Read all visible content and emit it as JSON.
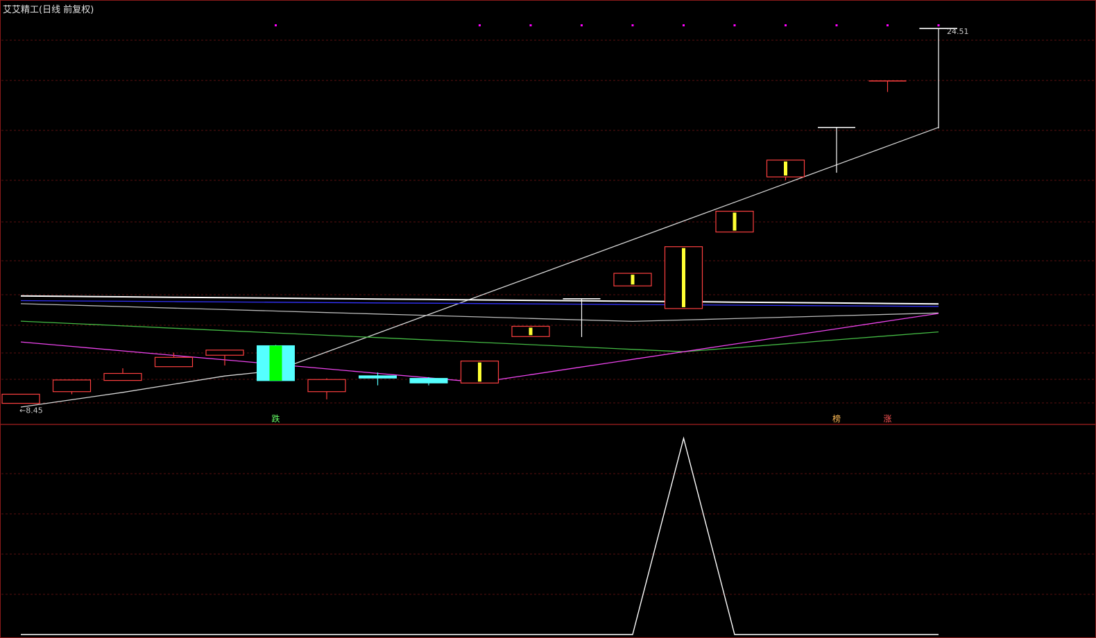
{
  "window": {
    "title": "艾艾精工(日线 前复权)"
  },
  "colors": {
    "background": "#000000",
    "border": "#8b1a1a",
    "grid": "#5a1010",
    "up": "#ff4040",
    "down": "#55ffff",
    "signal_bar": "#ffff33",
    "signal_bar_down": "#00ff00",
    "top_dot": "#ff00ff"
  },
  "chart_data": [
    {
      "type": "candlestick",
      "title": "艾艾精工(日线 前复权)",
      "grid": true,
      "candles": [
        {
          "open": 8.45,
          "close": 8.84,
          "high": 8.84,
          "low": 8.45,
          "dir": "up"
        },
        {
          "open": 8.95,
          "close": 9.45,
          "high": 9.45,
          "low": 8.84,
          "dir": "up"
        },
        {
          "open": 9.43,
          "close": 9.73,
          "high": 9.95,
          "low": 9.43,
          "dir": "up"
        },
        {
          "open": 10.02,
          "close": 10.42,
          "high": 10.62,
          "low": 10.02,
          "dir": "up"
        },
        {
          "open": 10.51,
          "close": 10.73,
          "high": 10.73,
          "low": 10.07,
          "dir": "up"
        },
        {
          "open": 10.92,
          "close": 9.42,
          "high": 10.95,
          "low": 9.42,
          "dir": "down",
          "signal": "down"
        },
        {
          "open": 8.95,
          "close": 9.47,
          "high": 9.52,
          "low": 8.62,
          "dir": "up"
        },
        {
          "open": 9.63,
          "close": 9.53,
          "high": 9.77,
          "low": 9.22,
          "dir": "down"
        },
        {
          "open": 9.52,
          "close": 9.32,
          "high": 9.57,
          "low": 9.22,
          "dir": "down"
        },
        {
          "open": 9.32,
          "close": 10.26,
          "high": 10.26,
          "low": 9.32,
          "dir": "up",
          "signal": "up"
        },
        {
          "open": 11.31,
          "close": 11.75,
          "high": 11.75,
          "low": 11.31,
          "dir": "up",
          "signal": "up"
        },
        {
          "open": 12.93,
          "close": 12.93,
          "high": 12.93,
          "low": 11.29,
          "dir": "flat"
        },
        {
          "open": 13.48,
          "close": 14.02,
          "high": 14.02,
          "low": 13.48,
          "dir": "up",
          "signal": "up"
        },
        {
          "open": 12.51,
          "close": 15.16,
          "high": 15.16,
          "low": 12.51,
          "dir": "up",
          "signal": "up"
        },
        {
          "open": 15.79,
          "close": 16.68,
          "high": 16.68,
          "low": 15.79,
          "dir": "up",
          "signal": "up"
        },
        {
          "open": 18.15,
          "close": 18.87,
          "high": 18.87,
          "low": 18.0,
          "dir": "up",
          "signal": "up"
        },
        {
          "open": 20.27,
          "close": 20.27,
          "high": 20.27,
          "low": 18.33,
          "dir": "flat"
        },
        {
          "open": 22.26,
          "close": 22.26,
          "high": 22.26,
          "low": 21.79,
          "dir": "flat",
          "color": "#ff4040"
        },
        {
          "open": 24.51,
          "close": 24.51,
          "high": 24.51,
          "low": 20.23,
          "dir": "flat"
        }
      ],
      "marks": {
        "low_label": "8.45",
        "high_label": "24.51"
      },
      "series": [
        {
          "color": "#d8d8d8",
          "values": [
            8.29,
            null,
            8.92,
            null,
            9.62,
            9.85,
            null,
            null,
            null,
            null,
            null,
            null,
            null,
            null,
            null,
            null,
            null,
            null,
            20.27
          ]
        },
        {
          "color": "#ffffff",
          "values": [
            13.05,
            null,
            null,
            null,
            null,
            null,
            null,
            null,
            null,
            null,
            null,
            null,
            null,
            null,
            null,
            null,
            null,
            null,
            12.71
          ]
        },
        {
          "color": "#3333ff",
          "values": [
            12.85,
            null,
            null,
            null,
            null,
            null,
            null,
            null,
            null,
            null,
            null,
            null,
            null,
            null,
            null,
            null,
            null,
            null,
            12.6
          ]
        },
        {
          "color": "#bbbbbb",
          "values": [
            12.72,
            null,
            null,
            null,
            null,
            null,
            null,
            null,
            null,
            null,
            null,
            null,
            11.96,
            null,
            null,
            null,
            null,
            null,
            12.32
          ]
        },
        {
          "color": "#44bb44",
          "values": [
            11.97,
            null,
            null,
            null,
            null,
            null,
            null,
            null,
            null,
            null,
            null,
            null,
            null,
            10.66,
            null,
            null,
            null,
            null,
            11.51
          ]
        },
        {
          "color": "#ee44ee",
          "values": [
            11.08,
            null,
            null,
            null,
            null,
            null,
            null,
            null,
            null,
            9.35,
            null,
            null,
            null,
            null,
            null,
            null,
            null,
            null,
            12.3
          ]
        }
      ],
      "signals": [
        {
          "index": 5,
          "text": "跌",
          "color": "#66ff66"
        },
        {
          "index": 16,
          "text": "榜",
          "color": "#ffbb55"
        },
        {
          "index": 17,
          "text": "涨",
          "color": "#ff5555"
        }
      ],
      "top_dots": [
        5,
        9,
        10,
        11,
        12,
        13,
        14,
        15,
        16,
        17,
        18
      ]
    },
    {
      "type": "line",
      "ylim": [
        0,
        1
      ],
      "series": [
        {
          "color": "#ffffff",
          "values": [
            0,
            0,
            0,
            0,
            0,
            0,
            0,
            0,
            0,
            0,
            0,
            0,
            0,
            1,
            0,
            0,
            0,
            0,
            0
          ]
        }
      ]
    }
  ]
}
